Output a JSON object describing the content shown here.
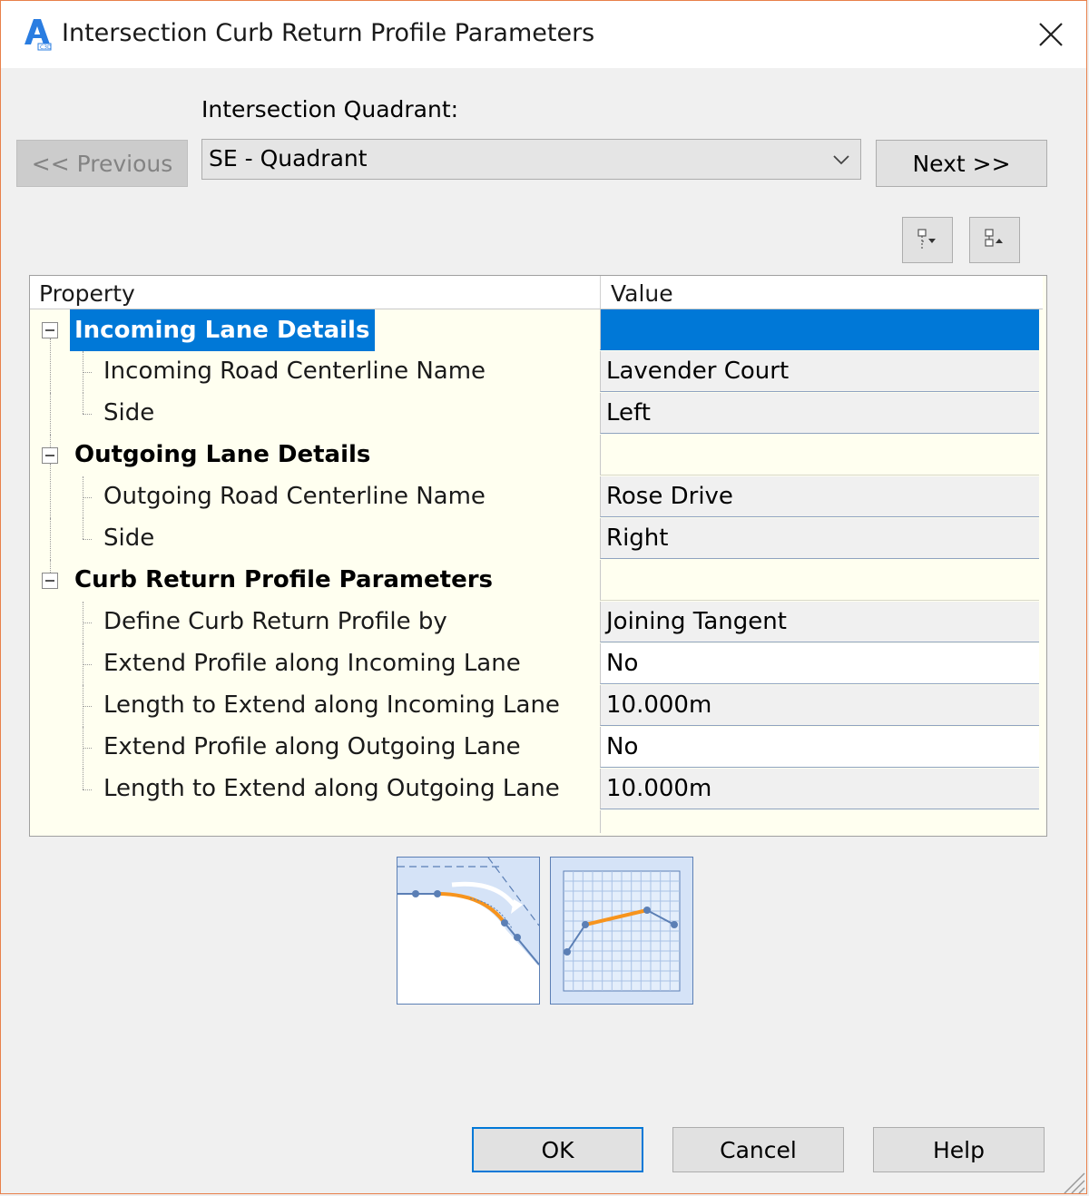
{
  "window": {
    "title": "Intersection Curb Return Profile Parameters",
    "app_icon": "autocad-civil3d-icon",
    "close_icon": "close-icon"
  },
  "quadrant": {
    "label": "Intersection Quadrant:",
    "selected": "SE - Quadrant",
    "previous_label": "<< Previous",
    "previous_enabled": false,
    "next_label": "Next >>"
  },
  "toolbar": {
    "expand_all_icon": "expand-all-icon",
    "collapse_all_icon": "collapse-all-icon"
  },
  "grid": {
    "header_property": "Property",
    "header_value": "Value",
    "categories": [
      {
        "label": "Incoming Lane Details",
        "selected": true,
        "items": [
          {
            "property": "Incoming Road Centerline Name",
            "value": "Lavender Court",
            "editable": false
          },
          {
            "property": "Side",
            "value": "Left",
            "editable": false
          }
        ]
      },
      {
        "label": "Outgoing Lane Details",
        "selected": false,
        "items": [
          {
            "property": "Outgoing Road Centerline Name",
            "value": "Rose Drive",
            "editable": false
          },
          {
            "property": "Side",
            "value": "Right",
            "editable": false
          }
        ]
      },
      {
        "label": "Curb Return Profile Parameters",
        "selected": false,
        "items": [
          {
            "property": "Define Curb Return Profile by",
            "value": "Joining Tangent",
            "editable": false
          },
          {
            "property": "Extend Profile along Incoming Lane",
            "value": "No",
            "editable": true
          },
          {
            "property": "Length to Extend along Incoming Lane",
            "value": "10.000m",
            "editable": false
          },
          {
            "property": "Extend Profile along Outgoing Lane",
            "value": "No",
            "editable": true
          },
          {
            "property": "Length to Extend along Outgoing Lane",
            "value": "10.000m",
            "editable": false
          }
        ]
      }
    ]
  },
  "previews": {
    "plan_icon": "curb-return-plan-preview",
    "profile_icon": "curb-return-profile-preview",
    "accent_color": "#f7941d"
  },
  "buttons": {
    "ok": "OK",
    "cancel": "Cancel",
    "help": "Help"
  }
}
